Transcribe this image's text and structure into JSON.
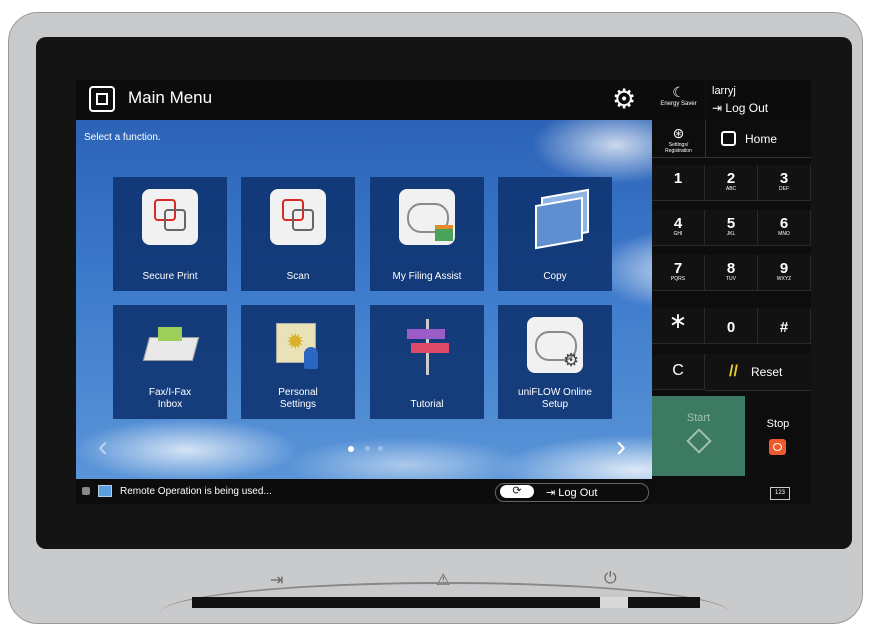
{
  "header": {
    "title": "Main Menu",
    "energy_saver_label": "Energy Saver",
    "username": "larryj",
    "logout_label": "Log Out"
  },
  "main": {
    "prompt": "Select a function.",
    "tiles": [
      {
        "label": "Secure Print",
        "icon": "secure-print-icon"
      },
      {
        "label": "Scan",
        "icon": "scan-icon"
      },
      {
        "label": "My Filing Assist",
        "icon": "cloud-filing-icon"
      },
      {
        "label": "Copy",
        "icon": "copy-icon"
      },
      {
        "label": "Fax/I-Fax\nInbox",
        "icon": "fax-inbox-icon"
      },
      {
        "label": "Personal\nSettings",
        "icon": "personal-settings-icon"
      },
      {
        "label": "Tutorial",
        "icon": "signpost-icon"
      },
      {
        "label": "uniFLOW Online\nSetup",
        "icon": "cloud-gear-icon"
      }
    ],
    "pagination": {
      "current": 1,
      "total": 3
    }
  },
  "statusbar": {
    "message": "Remote Operation is being used...",
    "logout_label": "Log Out"
  },
  "side": {
    "settings_label": "Settings/\nRegistration",
    "home_label": "Home",
    "keys": [
      {
        "digit": "1",
        "sub": ""
      },
      {
        "digit": "2",
        "sub": "ABC"
      },
      {
        "digit": "3",
        "sub": "DEF"
      },
      {
        "digit": "4",
        "sub": "GHI"
      },
      {
        "digit": "5",
        "sub": "JKL"
      },
      {
        "digit": "6",
        "sub": "MNO"
      },
      {
        "digit": "7",
        "sub": "PQRS"
      },
      {
        "digit": "8",
        "sub": "TUV"
      },
      {
        "digit": "9",
        "sub": "WXYZ"
      },
      {
        "digit": "∗",
        "sub": ""
      },
      {
        "digit": "0",
        "sub": ""
      },
      {
        "digit": "#",
        "sub": ""
      }
    ],
    "clear_label": "C",
    "reset_label": "Reset",
    "start_label": "Start",
    "stop_label": "Stop",
    "keyboard_label": "123"
  },
  "colors": {
    "tile_bg": "#0e326e",
    "start_bg": "#3d7a63",
    "stop_icon": "#ee5a2e",
    "reset_icon": "#e6cf2a"
  }
}
